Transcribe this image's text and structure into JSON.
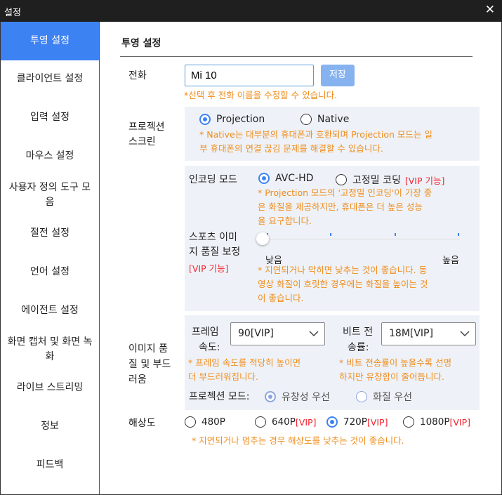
{
  "window": {
    "title": "설정",
    "close_glyph": "✕"
  },
  "sidebar": {
    "items": [
      {
        "label": "투영 설정",
        "active": true
      },
      {
        "label": "클라이언트 설정"
      },
      {
        "label": "입력 설정"
      },
      {
        "label": "마우스 설정"
      },
      {
        "label": "사용자 정의 도구 모음"
      },
      {
        "label": "절전 설정"
      },
      {
        "label": "언어 설정"
      },
      {
        "label": "에이전트 설정"
      },
      {
        "label": "화면 캡처 및 화면 녹화"
      },
      {
        "label": "라이브 스트리밍"
      },
      {
        "label": "정보"
      },
      {
        "label": "피드백"
      }
    ]
  },
  "main": {
    "title": "투영 설정",
    "phone": {
      "label": "전화",
      "value": "Mi 10",
      "save_label": "저장",
      "note": "*선택 후 전화 이름을 수정할 수 있습니다."
    },
    "projection_screen": {
      "label_line1": "프로젝션",
      "label_line2": "스크린",
      "options": [
        "Projection",
        "Native"
      ],
      "selected": "Projection",
      "note_line1": "* Native는 대부분의 휴대폰과 호환되며 Projection 모드는 일",
      "note_line2": "부 휴대폰의 연결 끊김 문제를 해결할 수 있습니다."
    },
    "encoding": {
      "label": "인코딩 모드",
      "options": [
        "AVC-HD",
        "고정밀 코딩"
      ],
      "vip_tag": "[VIP 기능]",
      "selected": "AVC-HD",
      "note_line1": "* Projection 모드의 '고정밀 인코딩'이 가장 좋",
      "note_line2": "은 화질을 제공하지만, 휴대폰은 더 높은 성능",
      "note_line3": "을 요구합니다."
    },
    "sports_quality": {
      "label_line1": "스포츠 이미",
      "label_line2": "지 품질 보정",
      "vip_tag": "[VIP 기능]",
      "low_label": "낮음",
      "high_label": "높음",
      "level": 0,
      "note_line1": "* 지연되거나 막히면 낮추는 것이 좋습니다. 동",
      "note_line2": "영상 화질이 흐릿한 경우에는 화질을 높이는 것",
      "note_line3": "이 좋습니다."
    },
    "image_quality": {
      "label_line1": "이미지 품",
      "label_line2": "질 및 부드",
      "label_line3": "러움",
      "frame_rate": {
        "label_line1": "프레임",
        "label_line2": "속도:",
        "value": "90[VIP]",
        "note_line1": "* 프레임 속도를 적당히 높이면",
        "note_line2": "더 부드러워집니다."
      },
      "bit_rate": {
        "label_line1": "비트 전",
        "label_line2": "송률:",
        "value": "18M[VIP]",
        "note_line1": "* 비트 전송률이 높을수록 선명",
        "note_line2": "하지만 유창함이 줄어듭니다."
      },
      "projection_mode": {
        "label": "프로젝션 모드:",
        "options": [
          "유창성 우선",
          "화질 우선"
        ],
        "selected": "유창성 우선"
      }
    },
    "resolution": {
      "label": "해상도",
      "options": [
        {
          "text": "480P",
          "vip": ""
        },
        {
          "text": "640P",
          "vip": "[VIP]"
        },
        {
          "text": "720P",
          "vip": "[VIP]"
        },
        {
          "text": "1080P",
          "vip": "[VIP]"
        }
      ],
      "selected": "720P",
      "note": "* 지연되거나 멈추는 경우 해상도를 낮추는 것이 좋습니다."
    }
  },
  "colors": {
    "accent": "#3d82f3",
    "note": "#f08c1a",
    "vip": "#f5222d",
    "panel": "#eef2f8"
  }
}
